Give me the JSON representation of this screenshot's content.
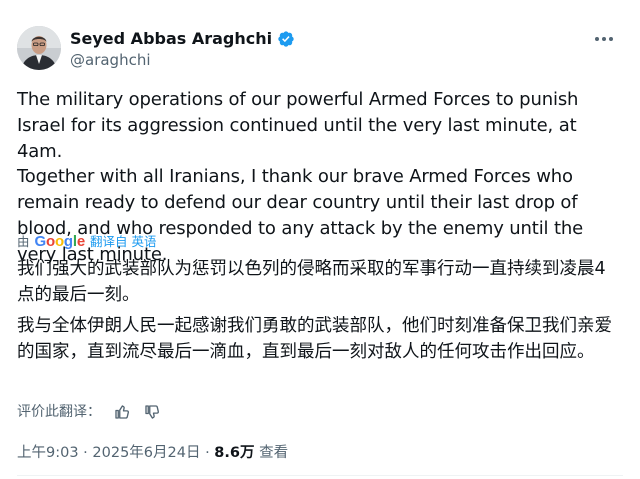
{
  "author": {
    "name": "Seyed Abbas Araghchi",
    "handle": "@araghchi"
  },
  "icons": {
    "verified": "verified-badge-icon",
    "more": "more-options-icon",
    "like": "thumbs-up-icon",
    "dislike": "thumbs-down-icon"
  },
  "colors": {
    "accent": "#1d9bf0",
    "secondary_text": "#536471"
  },
  "tweet": {
    "paragraph1": "The military operations of our powerful Armed Forces to punish Israel for its aggression continued until the very last minute, at 4am.",
    "paragraph2": "Together with all Iranians, I thank our brave Armed Forces who remain ready to defend our dear country until their last drop of blood, and who responded to any attack by the enemy until the very last minute."
  },
  "translation": {
    "by_prefix": "由",
    "provider": "Google",
    "link_text": "翻译自 英语",
    "paragraph1": "我们强大的武装部队为惩罚以色列的侵略而采取的军事行动一直持续到凌晨4点的最后一刻。",
    "paragraph2": "我与全体伊朗人民一起感谢我们勇敢的武装部队，他们时刻准备保卫我们亲爱的国家，直到流尽最后一滴血，直到最后一刻对敌人的任何攻击作出回应。"
  },
  "rating": {
    "label": "评价此翻译："
  },
  "meta": {
    "time": "上午9:03",
    "separator": "·",
    "date": "2025年6月24日",
    "views_count": "8.6万",
    "views_label": "查看"
  }
}
